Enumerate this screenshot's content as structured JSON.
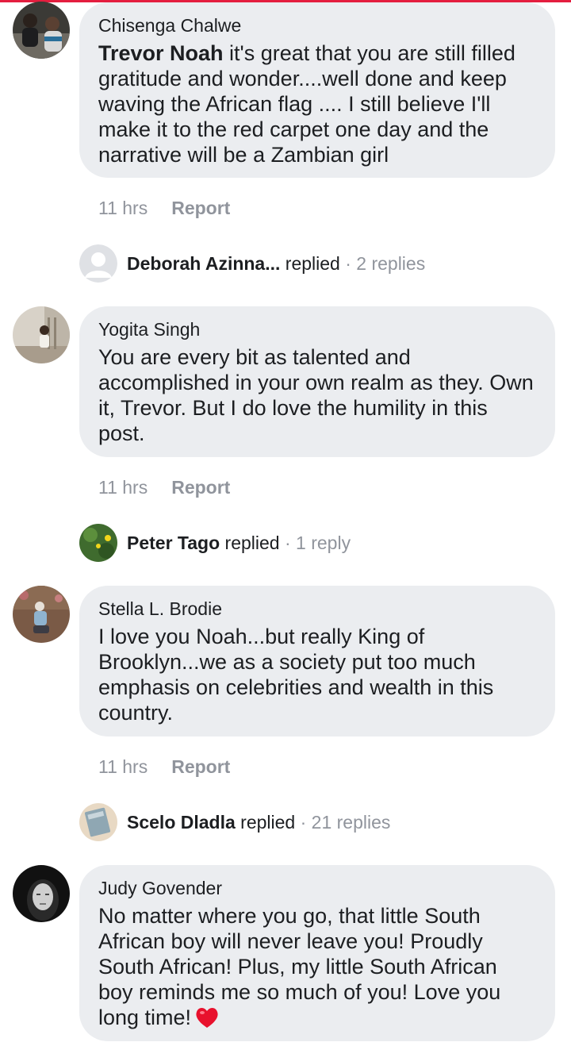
{
  "theme": {
    "accent": "#e41e3f",
    "bubble_bg": "#ebedf0",
    "meta_color": "#90949c",
    "heart_color": "#e8112d"
  },
  "comments": [
    {
      "author": "Chisenga Chalwe",
      "mention": "Trevor Noah",
      "text": " it's great that you are still filled gratitude and wonder....well done and keep waving the African flag .... I still believe I'll make it to the red carpet one day and the narrative will be a Zambian girl",
      "time": "11 hrs",
      "report_label": "Report",
      "avatar_icon": "profile-photo"
    },
    {
      "author": "Yogita Singh",
      "text": "You are every bit as talented and accomplished in your own realm as they. Own it, Trevor. But I do love the humility in this post.",
      "time": "11 hrs",
      "report_label": "Report",
      "avatar_icon": "profile-photo"
    },
    {
      "author": "Stella L. Brodie",
      "text": "I love you Noah...but really King of Brooklyn...we as a society put too much emphasis on celebrities and wealth in this country.",
      "time": "11 hrs",
      "report_label": "Report",
      "avatar_icon": "profile-photo"
    },
    {
      "author": "Judy Govender",
      "text": "No matter where you go, that little South African boy will never leave you! Proudly South African! Plus, my little South African boy reminds me so much of you! Love you long time!",
      "emoji": "heart-emoji",
      "avatar_icon": "profile-photo"
    }
  ],
  "replies": [
    {
      "name": "Deborah Azinna...",
      "verb": " replied",
      "count": " · 2 replies",
      "avatar_icon": "default-profile-icon"
    },
    {
      "name": "Peter Tago",
      "verb": " replied",
      "count": " · 1 reply",
      "avatar_icon": "profile-photo"
    },
    {
      "name": "Scelo Dladla",
      "verb": " replied",
      "count": " · 21 replies",
      "avatar_icon": "profile-photo"
    }
  ]
}
